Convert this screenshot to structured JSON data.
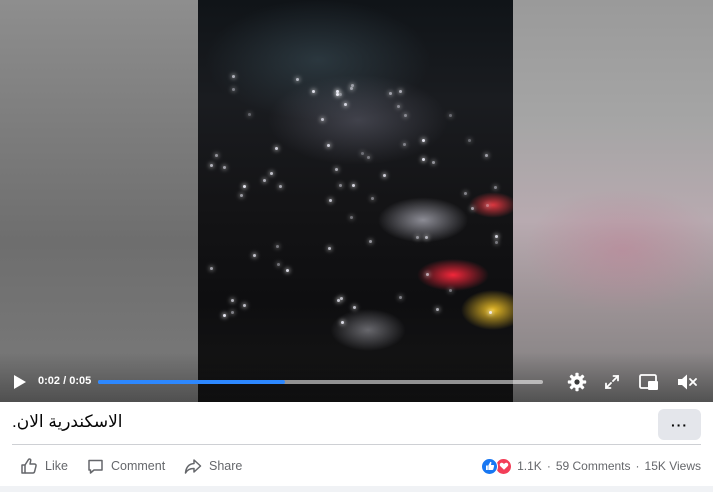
{
  "player": {
    "time_current": "0:02",
    "time_separator": " / ",
    "time_total": "0:05",
    "progress_fraction": 0.42,
    "accent_color": "#2d88ff"
  },
  "post": {
    "caption": "الاسكندرية الان.",
    "more_label": "···"
  },
  "actions": {
    "like_label": "Like",
    "comment_label": "Comment",
    "share_label": "Share"
  },
  "stats": {
    "reaction_icons": [
      "like-reaction-icon",
      "love-reaction-icon"
    ],
    "reaction_count": "1.1K",
    "comments": "59 Comments",
    "separator": "·",
    "views": "15K Views"
  },
  "colors": {
    "like_blue": "#1877f2",
    "love_red": "#f33e58",
    "secondary_text": "#65676b"
  }
}
